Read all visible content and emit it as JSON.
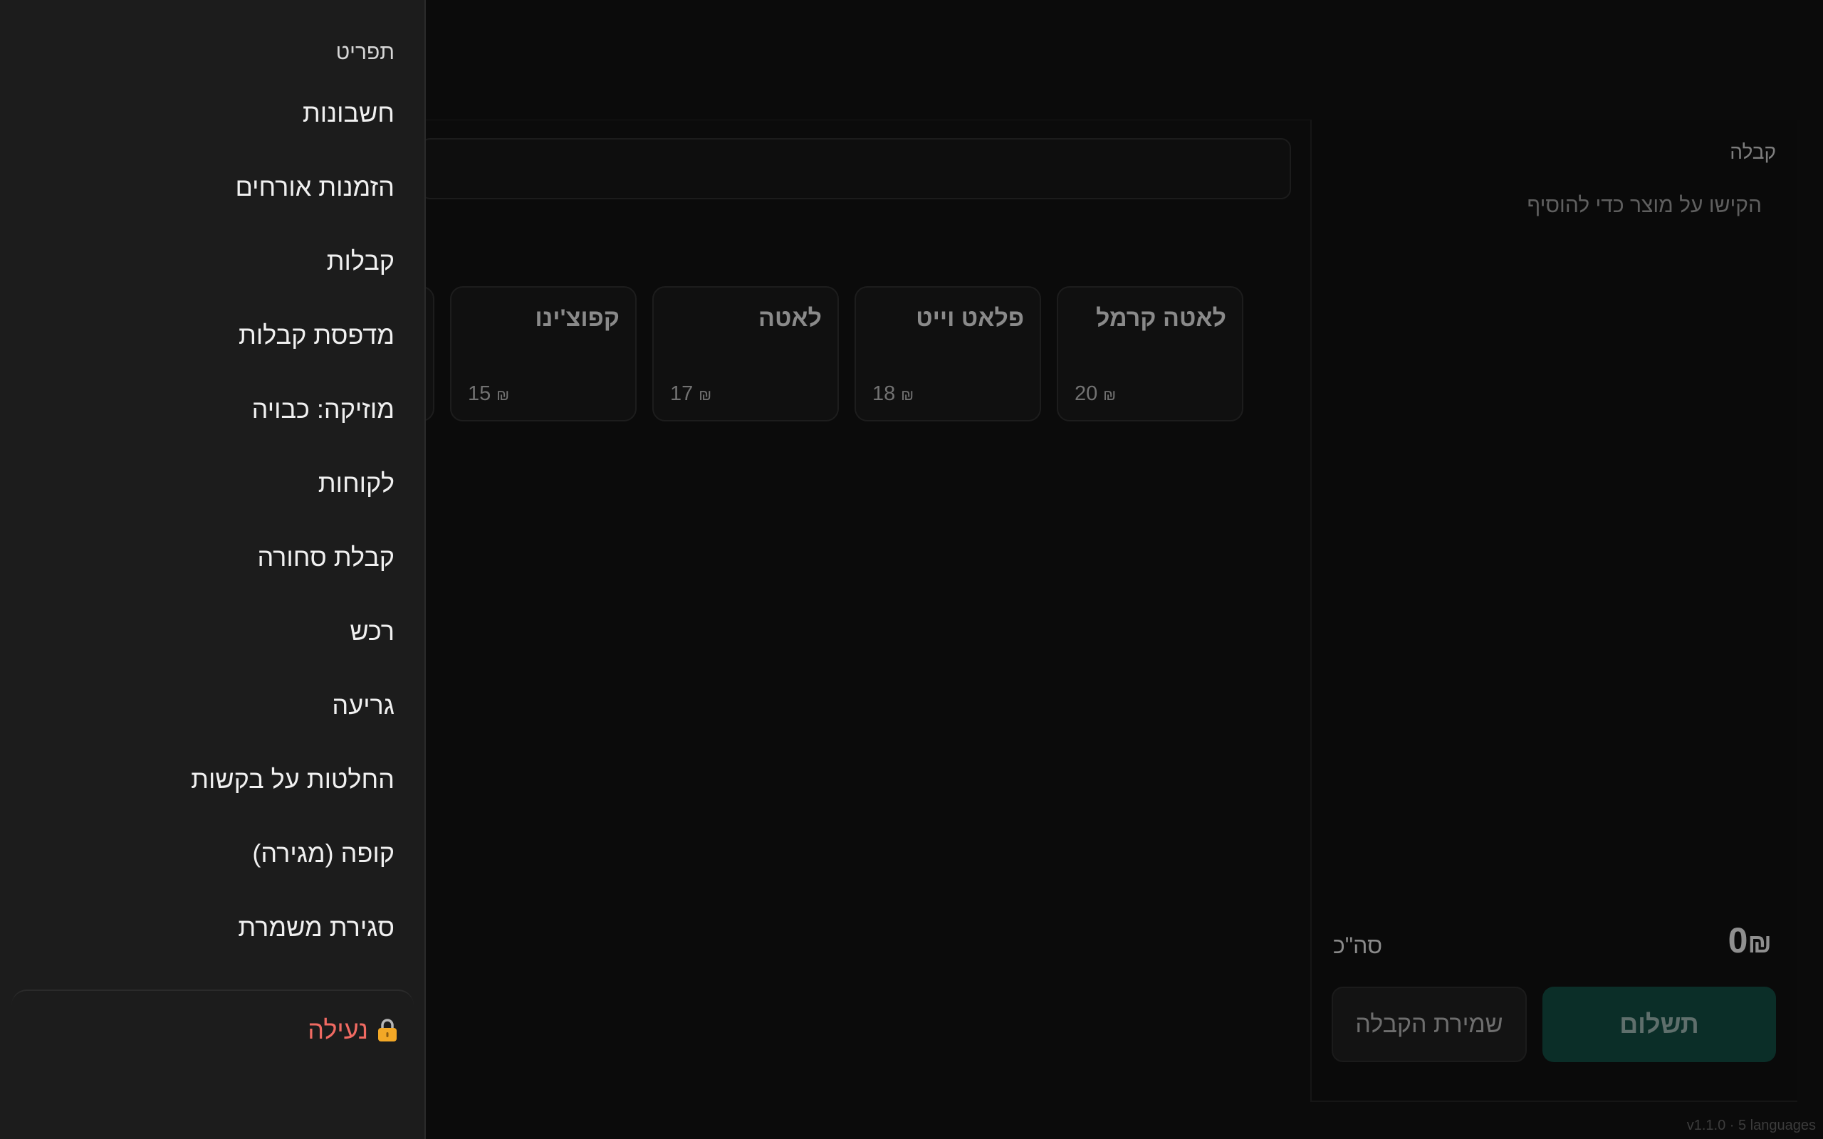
{
  "drawer": {
    "title": "תפריט",
    "items": [
      {
        "label": "חשבונות"
      },
      {
        "label": "הזמנות אורחים"
      },
      {
        "label": "קבלות"
      },
      {
        "label": "מדפסת קבלות"
      },
      {
        "label": "מוזיקה: כבויה"
      },
      {
        "label": "לקוחות"
      },
      {
        "label": "קבלת סחורה"
      },
      {
        "label": "רכש"
      },
      {
        "label": "גריעה"
      },
      {
        "label": "החלטות על בקשות"
      },
      {
        "label": "קופה (מגירה)"
      },
      {
        "label": "סגירת משמרת"
      }
    ],
    "lock_label": "נעילה"
  },
  "products": [
    {
      "name": "לאטה קרמל",
      "price": "20",
      "currency": "₪"
    },
    {
      "name": "פלאט וייט",
      "price": "18",
      "currency": "₪"
    },
    {
      "name": "לאטה",
      "price": "17",
      "currency": "₪"
    },
    {
      "name": "קפוצ'ינו",
      "price": "15",
      "currency": "₪"
    }
  ],
  "receipt": {
    "title": "קבלה",
    "empty_hint": "הקישו על מוצר כדי להוסיף",
    "total_label": "סה\"כ",
    "total_amount": "0",
    "currency": "₪",
    "save_label": "שמירת הקבלה",
    "pay_label": "תשלום"
  },
  "footer": {
    "version": "v1.1.0 · 5 languages"
  },
  "colors": {
    "accent": "#0b2e28",
    "danger": "#f06a62",
    "drawer_bg": "#1c1c1c"
  }
}
